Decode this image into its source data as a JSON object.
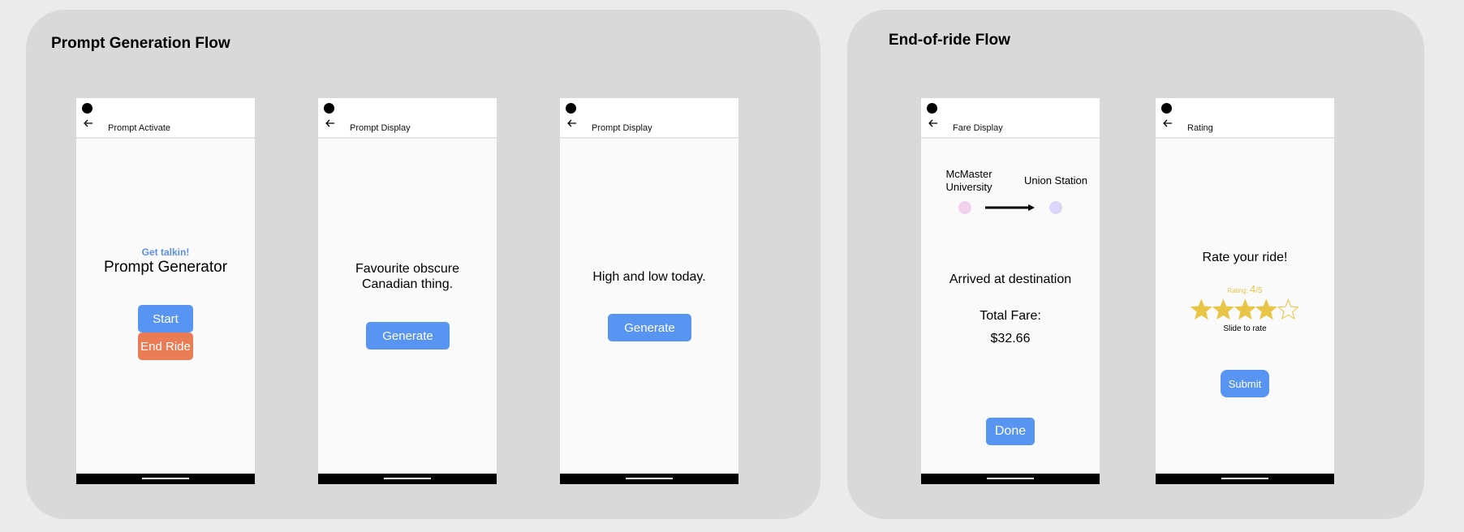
{
  "flows": {
    "prompt_generation": {
      "title": "Prompt Generation Flow",
      "screens": {
        "activate": {
          "appbar_title": "Prompt Activate",
          "kicker": "Get talkin!",
          "heading": "Prompt Generator",
          "start_label": "Start",
          "end_ride_label": "End Ride"
        },
        "display1": {
          "appbar_title": "Prompt Display",
          "prompt_line1": "Favourite obscure",
          "prompt_line2": "Canadian thing.",
          "generate_label": "Generate"
        },
        "display2": {
          "appbar_title": "Prompt Display",
          "prompt": "High and low today.",
          "generate_label": "Generate"
        }
      }
    },
    "end_of_ride": {
      "title": "End-of-ride Flow",
      "screens": {
        "fare": {
          "appbar_title": "Fare Display",
          "origin_line1": "McMaster",
          "origin_line2": "University",
          "destination": "Union Station",
          "arrived": "Arrived at destination",
          "total_fare_label": "Total Fare:",
          "total_fare_value": "$32.66",
          "done_label": "Done"
        },
        "rating": {
          "appbar_title": "Rating",
          "heading": "Rate your ride!",
          "rating_prefix": "Rating: ",
          "rating_value": "4",
          "rating_suffix": "/5",
          "rating_number": 4,
          "rating_max": 5,
          "slide_hint": "Slide to rate",
          "submit_label": "Submit"
        }
      }
    }
  },
  "colors": {
    "button_blue": "#5894f2",
    "button_orange": "#e97b55",
    "kicker_blue": "#5b8fe6",
    "star_gold": "#e8c547",
    "origin_dot": "#f2d2ee",
    "destination_dot": "#dcd6fb"
  },
  "icons": {
    "back": "arrow-left-icon",
    "status": "camera-dot-icon",
    "star": "star-icon",
    "route": "arrow-right-icon"
  }
}
